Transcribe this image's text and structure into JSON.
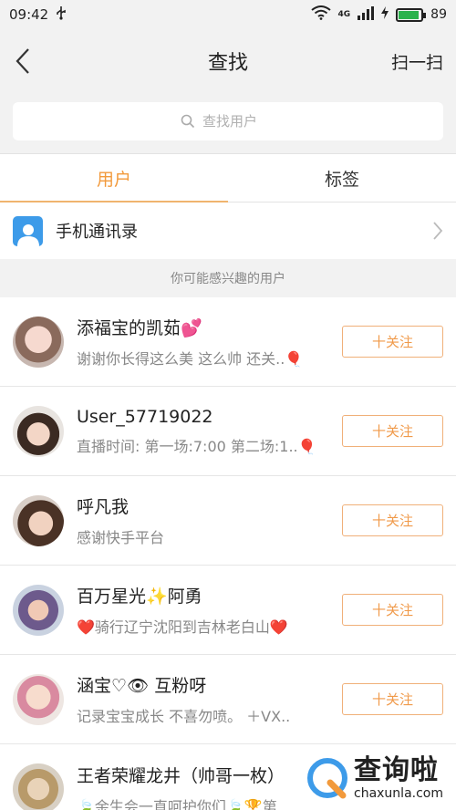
{
  "status_bar": {
    "time": "09:42",
    "network": "4G",
    "battery": "89",
    "battery_level": 0.89
  },
  "nav": {
    "title": "查找",
    "action": "扫一扫"
  },
  "search": {
    "placeholder": "查找用户"
  },
  "tabs": [
    {
      "label": "用户",
      "active": true
    },
    {
      "label": "标签",
      "active": false
    }
  ],
  "contacts": {
    "label": "手机通讯录"
  },
  "section": {
    "title": "你可能感兴趣的用户"
  },
  "follow_label": "十关注",
  "users": [
    {
      "name": "添福宝的凯茹💕",
      "desc": "谢谢你长得这么美 这么帅 还关..🎈"
    },
    {
      "name": "User_57719022",
      "desc": "直播时间: 第一场:7:00 第二场:1..🎈"
    },
    {
      "name": "呼凡我",
      "desc": "感谢快手平台"
    },
    {
      "name": "百万星光✨阿勇",
      "desc": "❤️骑行辽宁沈阳到吉林老白山❤️"
    },
    {
      "name": "涵宝♡👁 互粉呀",
      "desc": "记录宝宝成长 不喜勿喷。 ＋VX.."
    },
    {
      "name": "王者荣耀龙井（帅哥一枚）",
      "desc": "🍃余生会一直呵护你们🍃🏆第.."
    }
  ],
  "watermark": {
    "cn": "查询啦",
    "en": "chaxunla.com"
  },
  "colors": {
    "accent": "#f29a3c",
    "contacts_icon": "#3d9be9",
    "battery": "#2bb24c"
  }
}
